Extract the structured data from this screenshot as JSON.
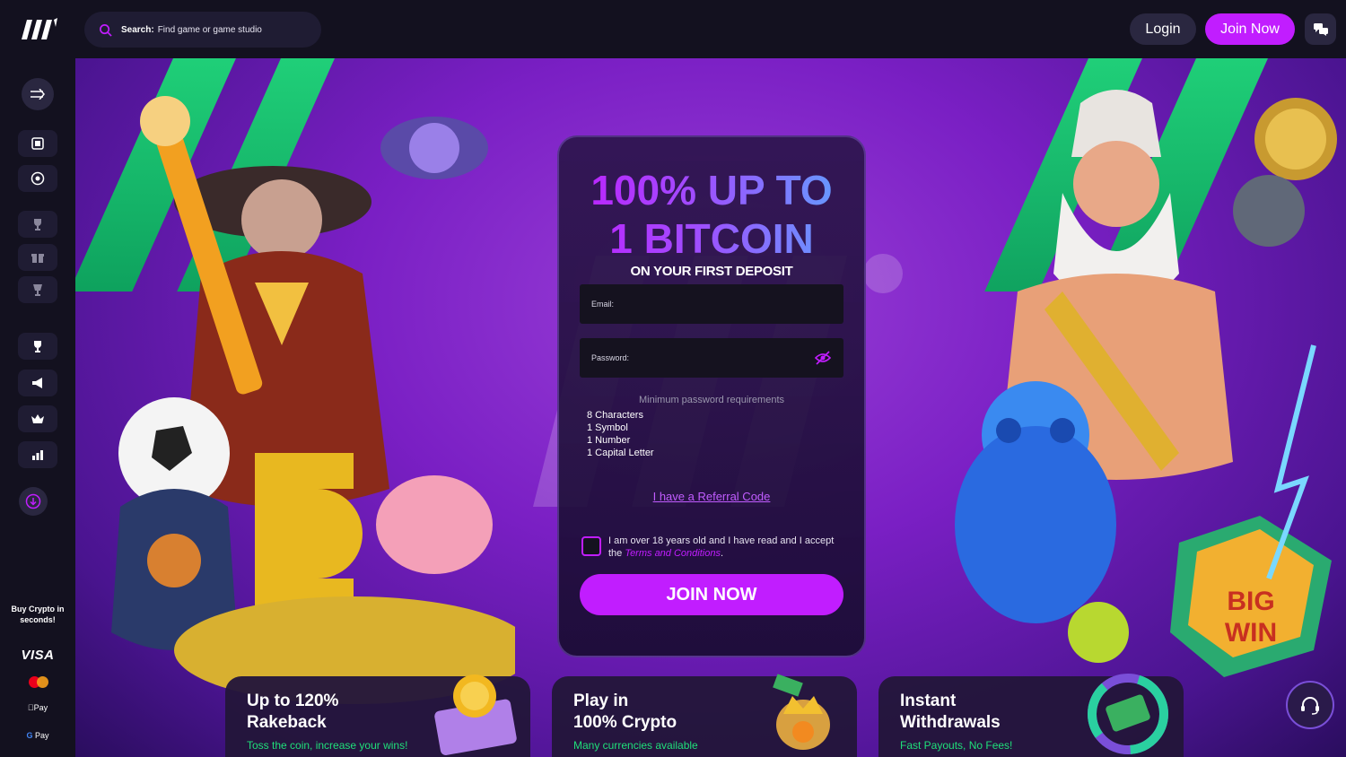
{
  "header": {
    "search_label": "Search:",
    "search_placeholder": "Find game or game studio",
    "login_label": "Login",
    "join_label": "Join Now"
  },
  "sidebar": {
    "items": [
      "casino-icon",
      "sports-icon",
      "trophy-icon",
      "gift-icon",
      "cup-icon",
      "tournament-icon",
      "promotions-icon",
      "vip-icon",
      "leaderboard-icon"
    ],
    "buy_crypto": "Buy Crypto in seconds!",
    "payments": {
      "visa": "VISA",
      "apple_pay": "Pay",
      "google_pay": "Pay"
    }
  },
  "form": {
    "headline_line1": "100% UP TO",
    "headline_line2": "1 BITCOIN",
    "subheadline": "ON YOUR FIRST DEPOSIT",
    "email_label": "Email:",
    "password_label": "Password:",
    "requirements_title": "Minimum password requirements",
    "requirements": [
      "8 Characters",
      "1 Symbol",
      "1 Number",
      "1 Capital Letter"
    ],
    "referral_link": "I have a Referral Code",
    "terms_prefix": "I am over 18 years old and I have read and I accept the ",
    "terms_link": "Terms and Conditions",
    "terms_suffix": ".",
    "submit_label": "JOIN NOW"
  },
  "features": [
    {
      "title_line1": "Up to 120%",
      "title_line2": "Rakeback",
      "subtitle": "Toss the coin, increase your wins!"
    },
    {
      "title_line1": "Play in",
      "title_line2": "100% Crypto",
      "subtitle": "Many currencies available"
    },
    {
      "title_line1": "Instant",
      "title_line2": "Withdrawals",
      "subtitle": "Fast Payouts, No Fees!"
    }
  ],
  "colors": {
    "accent": "#c11dff",
    "green": "#1fe07a",
    "background": "#13111f",
    "hero_purple": "#7a1fc4"
  }
}
